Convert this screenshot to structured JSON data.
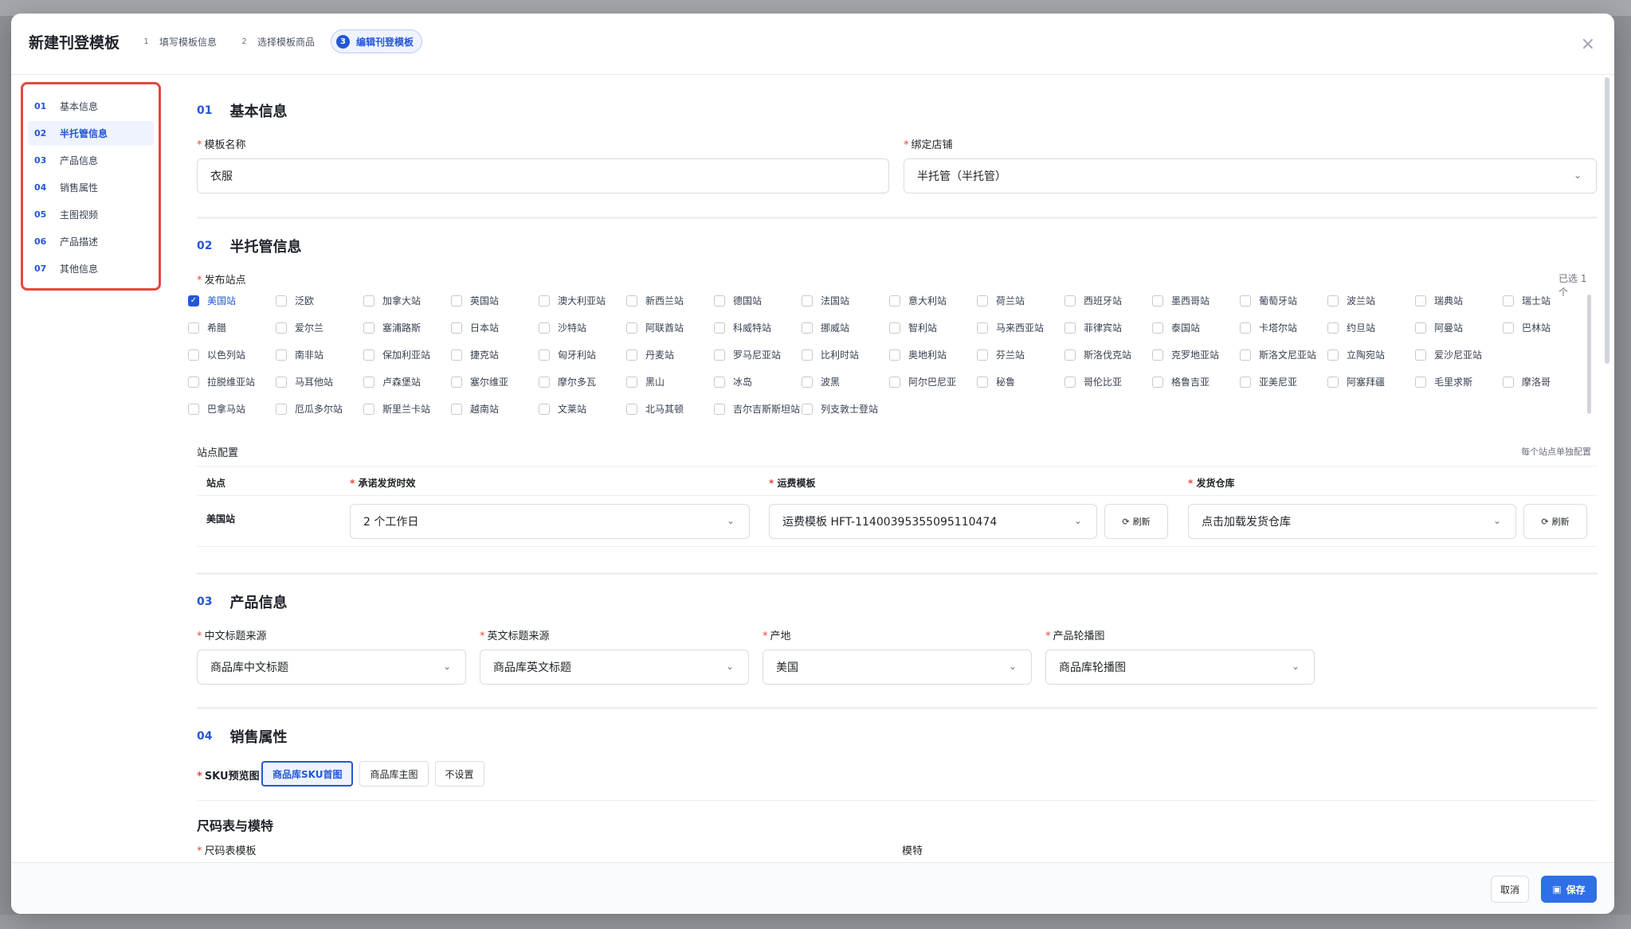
{
  "modal": {
    "title": "新建刊登模板",
    "close_label": "×",
    "steps": [
      {
        "num": "1",
        "label": "填写模板信息"
      },
      {
        "num": "2",
        "label": "选择模板商品"
      },
      {
        "num": "3",
        "label": "编辑刊登模板"
      }
    ]
  },
  "sidenav": [
    {
      "num": "01",
      "label": "基本信息"
    },
    {
      "num": "02",
      "label": "半托管信息"
    },
    {
      "num": "03",
      "label": "产品信息"
    },
    {
      "num": "04",
      "label": "销售属性"
    },
    {
      "num": "05",
      "label": "主图视频"
    },
    {
      "num": "06",
      "label": "产品描述"
    },
    {
      "num": "07",
      "label": "其他信息"
    }
  ],
  "basic": {
    "num": "01",
    "title": "基本信息",
    "template_name_label": "模板名称",
    "template_name_value": "衣服",
    "store_label": "绑定店铺",
    "store_value": "半托管（半托管）"
  },
  "semi": {
    "num": "02",
    "title": "半托管信息",
    "sites_label": "发布站点",
    "selected_count": "已选 1 个",
    "sites": [
      [
        "美国站",
        "泛欧",
        "加拿大站",
        "英国站",
        "澳大利亚站",
        "新西兰站",
        "德国站",
        "法国站",
        "意大利站",
        "荷兰站",
        "西班牙站",
        "墨西哥站",
        "葡萄牙站",
        "波兰站",
        "瑞典站",
        "瑞士站"
      ],
      [
        "希腊",
        "爱尔兰",
        "塞浦路斯",
        "日本站",
        "沙特站",
        "阿联酋站",
        "科威特站",
        "挪威站",
        "智利站",
        "马来西亚站",
        "菲律宾站",
        "泰国站",
        "卡塔尔站",
        "约旦站",
        "阿曼站",
        "巴林站"
      ],
      [
        "以色列站",
        "南非站",
        "保加利亚站",
        "捷克站",
        "匈牙利站",
        "丹麦站",
        "罗马尼亚站",
        "比利时站",
        "奥地利站",
        "芬兰站",
        "斯洛伐克站",
        "克罗地亚站",
        "斯洛文尼亚站",
        "立陶宛站",
        "爱沙尼亚站"
      ],
      [
        "拉脱维亚站",
        "马耳他站",
        "卢森堡站",
        "塞尔维亚",
        "摩尔多瓦",
        "黑山",
        "冰岛",
        "波黑",
        "阿尔巴尼亚",
        "秘鲁",
        "哥伦比亚",
        "格鲁吉亚",
        "亚美尼亚",
        "阿塞拜疆",
        "毛里求斯",
        "摩洛哥"
      ],
      [
        "巴拿马站",
        "厄瓜多尔站",
        "斯里兰卡站",
        "越南站",
        "文莱站",
        "北马其顿",
        "吉尔吉斯斯坦站",
        "列支敦士登站"
      ]
    ],
    "config_label": "站点配置",
    "config_hint": "每个站点单独配置",
    "table_headers": {
      "site": "站点",
      "ship_time": "承诺发货时效",
      "freight": "运费模板",
      "warehouse": "发货仓库"
    },
    "row": {
      "site": "美国站",
      "ship_time": "2 个工作日",
      "freight": "运费模板 HFT-11400395355095110474",
      "warehouse": "点击加载发货仓库",
      "refresh": "刷新"
    }
  },
  "product": {
    "num": "03",
    "title": "产品信息",
    "fields": [
      {
        "label": "中文标题来源",
        "value": "商品库中文标题"
      },
      {
        "label": "英文标题来源",
        "value": "商品库英文标题"
      },
      {
        "label": "产地",
        "value": "美国"
      },
      {
        "label": "产品轮播图",
        "value": "商品库轮播图"
      }
    ]
  },
  "sales": {
    "num": "04",
    "title": "销售属性",
    "sku_label": "SKU预览图",
    "sku_options": [
      "商品库SKU首图",
      "商品库主图",
      "不设置"
    ],
    "size_title": "尺码表与模特",
    "size_template_label": "尺码表模板",
    "model_label": "模特"
  },
  "footer": {
    "cancel": "取消",
    "save": "保存"
  }
}
